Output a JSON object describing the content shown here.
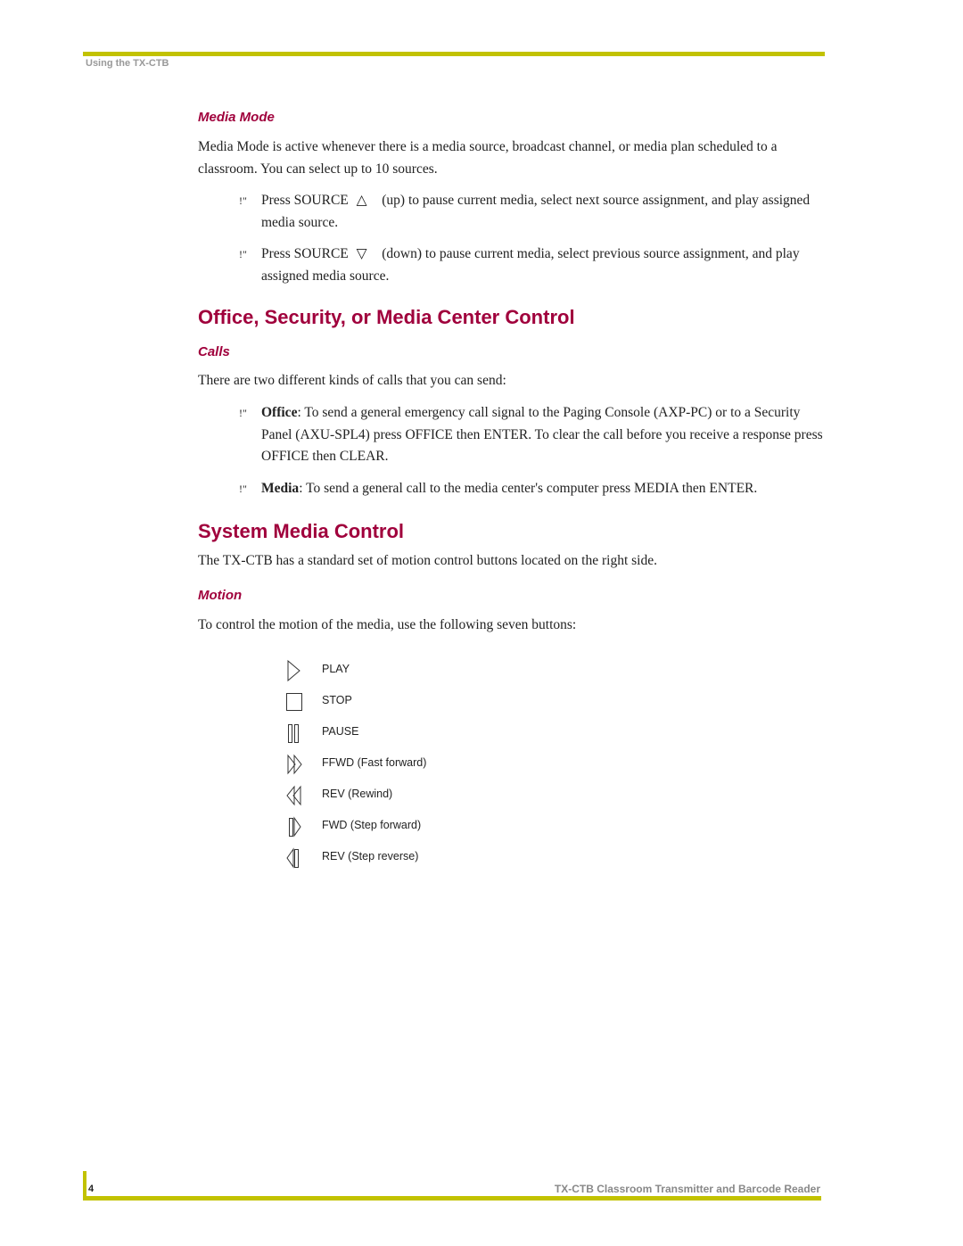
{
  "header": {
    "running_head": "Using the TX-CTB"
  },
  "media_mode": {
    "heading": "Media Mode",
    "intro": "Media Mode is active whenever there is a media source, broadcast channel, or media plan scheduled to a classroom. You can select up to 10 sources.",
    "bullets": [
      {
        "marker": "!\"",
        "pre": "Press SOURCE",
        "icon": "△",
        "post": "(up) to pause current media, select next source assignment, and play assigned media source."
      },
      {
        "marker": "!\"",
        "pre": "Press SOURCE",
        "icon": "▽",
        "post": "(down) to pause current media, select previous source assignment, and play assigned media source."
      }
    ]
  },
  "office": {
    "heading": "Office, Security, or Media Center Control",
    "sub": "Calls",
    "intro": "There are two different kinds of calls that you can send:",
    "bullets": [
      {
        "marker": "!\"",
        "term": "Office",
        "text": ": To send a general emergency call signal to the Paging Console (AXP-PC) or to a Security Panel (AXU-SPL4) press OFFICE then ENTER. To clear the call before you receive a response press OFFICE then CLEAR."
      },
      {
        "marker": "!\"",
        "term": "Media",
        "text": ": To send a general call to the media center's computer press MEDIA then ENTER."
      }
    ]
  },
  "system": {
    "heading": "System Media Control",
    "intro": "The TX-CTB has a standard set of motion control buttons located on the right side.",
    "sub": "Motion",
    "motion_intro": "To control the motion of the media, use the following seven buttons:",
    "controls": [
      {
        "icon": "play-icon",
        "label": "PLAY"
      },
      {
        "icon": "stop-icon",
        "label": "STOP"
      },
      {
        "icon": "pause-icon",
        "label": "PAUSE"
      },
      {
        "icon": "fast-forward-icon",
        "label": "FFWD (Fast forward)"
      },
      {
        "icon": "rewind-icon",
        "label": "REV (Rewind)"
      },
      {
        "icon": "step-forward-icon",
        "label": "FWD (Step forward)"
      },
      {
        "icon": "step-reverse-icon",
        "label": "REV (Step reverse)"
      }
    ]
  },
  "footer": {
    "page_number": "4",
    "title": "TX-CTB Classroom Transmitter and Barcode Reader"
  }
}
